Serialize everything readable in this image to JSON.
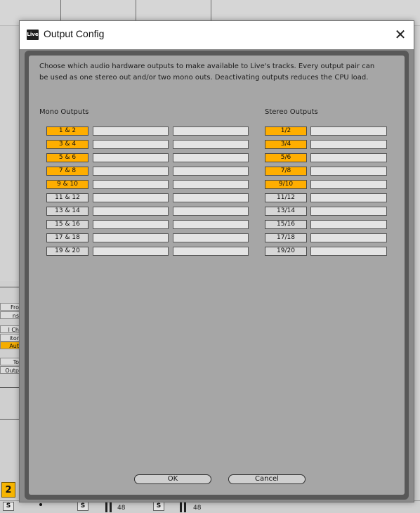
{
  "dialog": {
    "app_icon_text": "Live",
    "title": "Output Config",
    "close_glyph": "✕",
    "description": "Choose which audio hardware outputs to make available to Live's tracks. Every output pair can be used as one stereo out and/or two mono outs.  Deactivating outputs reduces the CPU load.",
    "mono_header": "Mono Outputs",
    "stereo_header": "Stereo Outputs",
    "ok_label": "OK",
    "cancel_label": "Cancel",
    "active_color": "#ffae00",
    "inactive_color": "#d7d7d7"
  },
  "mono_outputs": [
    {
      "label": "1 & 2",
      "active": true
    },
    {
      "label": "3 & 4",
      "active": true
    },
    {
      "label": "5 & 6",
      "active": true
    },
    {
      "label": "7 & 8",
      "active": true
    },
    {
      "label": "9 & 10",
      "active": true
    },
    {
      "label": "11 & 12",
      "active": false
    },
    {
      "label": "13 & 14",
      "active": false
    },
    {
      "label": "15 & 16",
      "active": false
    },
    {
      "label": "17 & 18",
      "active": false
    },
    {
      "label": "19 & 20",
      "active": false
    }
  ],
  "stereo_outputs": [
    {
      "label": "1/2",
      "active": true
    },
    {
      "label": "3/4",
      "active": true
    },
    {
      "label": "5/6",
      "active": true
    },
    {
      "label": "7/8",
      "active": true
    },
    {
      "label": "9/10",
      "active": true
    },
    {
      "label": "11/12",
      "active": false
    },
    {
      "label": "13/14",
      "active": false
    },
    {
      "label": "15/16",
      "active": false
    },
    {
      "label": "17/18",
      "active": false
    },
    {
      "label": "19/20",
      "active": false
    }
  ],
  "background": {
    "left_labels": [
      "Fro",
      "ns",
      "l Ch",
      "itor",
      "Aut",
      "To",
      "Outp"
    ],
    "track_number": "2",
    "solo_label": "S",
    "meter_db": "48"
  }
}
